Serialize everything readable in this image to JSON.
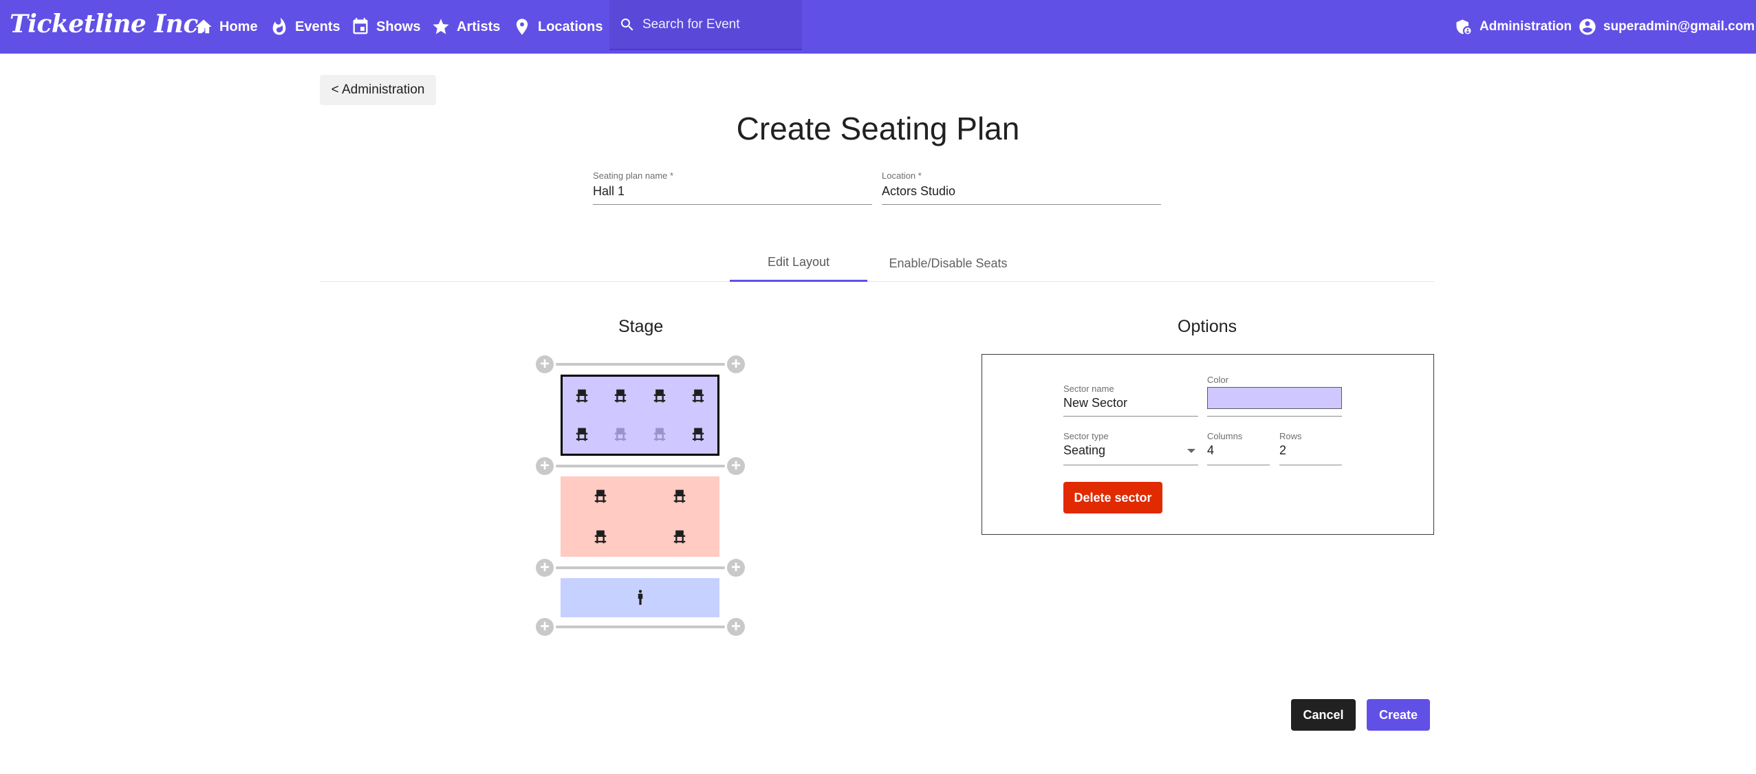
{
  "app": {
    "brand": "Ticketline Inc."
  },
  "nav": {
    "home": "Home",
    "events": "Events",
    "shows": "Shows",
    "artists": "Artists",
    "locations": "Locations",
    "search_placeholder": "Search for Event",
    "administration": "Administration",
    "user": "superadmin@gmail.com"
  },
  "page": {
    "back_label": "< Administration",
    "title": "Create Seating Plan",
    "name_label": "Seating plan name *",
    "name_value": "Hall 1",
    "location_label": "Location *",
    "location_value": "Actors Studio",
    "tabs": [
      "Edit Layout",
      "Enable/Disable Seats"
    ],
    "active_tab": 0
  },
  "editor": {
    "title": "Stage",
    "sectors": [
      {
        "type": "Seating",
        "color": "#cfc7ff",
        "selected": true,
        "columns": 4,
        "rows": 2,
        "disabled_seats": [
          [
            1,
            1
          ],
          [
            1,
            2
          ]
        ]
      },
      {
        "type": "Seating",
        "color": "#ffcbc2",
        "selected": false,
        "columns": 2,
        "rows": 2,
        "disabled_seats": []
      },
      {
        "type": "Standing",
        "color": "#c7d1ff",
        "selected": false
      }
    ]
  },
  "options": {
    "title": "Options",
    "sector_name_label": "Sector name",
    "sector_name_value": "New Sector",
    "color_label": "Color",
    "color_value": "#cfc7ff",
    "sector_type_label": "Sector type",
    "sector_type_value": "Seating",
    "columns_label": "Columns",
    "columns_value": "4",
    "rows_label": "Rows",
    "rows_value": "2",
    "delete_label": "Delete sector"
  },
  "actions": {
    "cancel": "Cancel",
    "create": "Create"
  },
  "colors": {
    "primary": "#6150e6",
    "danger": "#e12a00",
    "dark": "#212121"
  }
}
